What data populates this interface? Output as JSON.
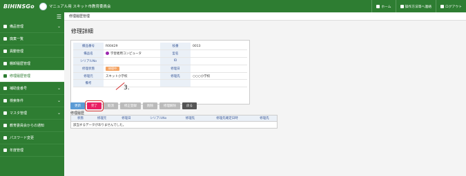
{
  "topbar": {
    "logo": "BIHINSGo",
    "org_name": "マニュアル用 スキット市教育委員会",
    "home": "ホーム",
    "note": "操作方法等へ連絡",
    "logout": "ログアウト"
  },
  "sidebar": {
    "items": [
      {
        "label": "備品管理",
        "chevron": true
      },
      {
        "label": "廃棄一覧",
        "chevron": false
      },
      {
        "label": "異動管理",
        "chevron": false
      },
      {
        "label": "棚卸履歴管理",
        "chevron": false
      },
      {
        "label": "修理履歴管理",
        "chevron": false,
        "active": true
      },
      {
        "label": "補助金番号",
        "chevron": true
      },
      {
        "label": "検索条件",
        "chevron": true
      },
      {
        "label": "マスタ管理",
        "chevron": true
      },
      {
        "label": "教育委員会からの通知",
        "chevron": false
      },
      {
        "label": "パスワード変更",
        "chevron": false
      },
      {
        "label": "年度管理",
        "chevron": false
      }
    ]
  },
  "breadcrumb": "修理履歴管理",
  "page_title": "修理詳細",
  "detail": {
    "rows": [
      {
        "l1": "備品番号",
        "v1": "R00429",
        "l2": "枝番",
        "v2": "0013"
      },
      {
        "l1": "備品名",
        "v1": "学習者用コンピュータ",
        "l2": "型名",
        "v2": ""
      },
      {
        "l1": "シリアルNo",
        "v1": "",
        "l2": "ID",
        "v2": ""
      },
      {
        "l1": "修理状態",
        "v1": "",
        "l2": "修理日",
        "v2": ""
      },
      {
        "l1": "修理元",
        "v1": "スキット小学校",
        "l2": "修理先",
        "v2": "○○○小学校"
      },
      {
        "l1": "備考",
        "v1": "",
        "l2": "",
        "v2": ""
      }
    ],
    "status_badge": "修理中"
  },
  "annotation": "3.",
  "buttons": [
    "更新",
    "完了",
    "取消",
    "修正登録",
    "削除",
    "修理解除",
    "戻る"
  ],
  "history": {
    "title": "修理履歴",
    "columns": [
      "状態",
      "修理元",
      "修理日",
      "シリアルNo",
      "修理先",
      "修理先確定日時",
      "修理先"
    ],
    "empty": "該当するデータがありませんでした。"
  }
}
